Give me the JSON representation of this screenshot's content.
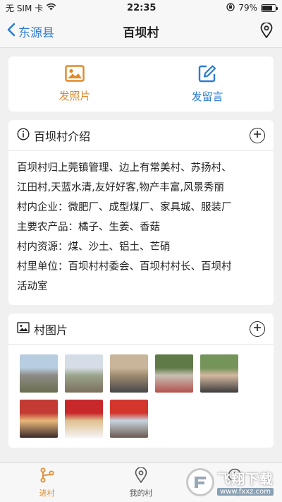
{
  "status": {
    "carrier": "无 SIM 卡",
    "time": "22:35",
    "battery": "79%",
    "battery_level": 0.79
  },
  "nav": {
    "back_label": "东源县",
    "title": "百坝村"
  },
  "actions": {
    "photo_label": "发照片",
    "message_label": "发留言"
  },
  "intro": {
    "title": "百坝村介绍",
    "lines": [
      "百坝村归上莞镇管理、边上有常美村、苏扬村、",
      "江田村,天蓝水清,友好好客,物产丰富,风景秀丽",
      "村内企业：微肥厂、成型煤厂、家具城、服装厂",
      "主要农产品：橘子、生姜、香菇",
      "村内资源：煤、沙土、铝土、芒硝",
      "村里单位：百坝村村委会、百坝村村长、百坝村",
      "活动室"
    ]
  },
  "gallery": {
    "title": "村图片",
    "photos": [
      {
        "label": "photo-1",
        "colors": [
          "#b7cde0",
          "#8d8c86",
          "#6a6e4f"
        ]
      },
      {
        "label": "photo-2",
        "colors": [
          "#d5dde6",
          "#9aa58a",
          "#7b6f5d"
        ]
      },
      {
        "label": "photo-3",
        "colors": [
          "#c9b59a",
          "#9f8c70",
          "#46464a"
        ]
      },
      {
        "label": "photo-4",
        "colors": [
          "#5f7a46",
          "#c8c0b4",
          "#b4524e"
        ]
      },
      {
        "label": "photo-5",
        "colors": [
          "#74945a",
          "#d4b8a0",
          "#3c3c3c"
        ]
      },
      {
        "label": "photo-6",
        "colors": [
          "#c33b33",
          "#e8b77a",
          "#3a2a2a"
        ]
      },
      {
        "label": "photo-7",
        "colors": [
          "#c9282b",
          "#e0c090",
          "#f4f4f4"
        ]
      },
      {
        "label": "photo-8",
        "colors": [
          "#d3372c",
          "#c9d4de",
          "#6a5a50"
        ]
      }
    ]
  },
  "tabs": [
    {
      "label": "进村",
      "icon": "route-icon",
      "active": true
    },
    {
      "label": "我的村",
      "icon": "location-pin-icon",
      "active": false
    },
    {
      "label": "关于",
      "icon": "info-icon",
      "active": false
    }
  ],
  "watermark": {
    "title": "飞翔下载",
    "url": "www.fxxz.com"
  },
  "colors": {
    "accent": "#e08a2c",
    "blue": "#2b7cd3"
  }
}
